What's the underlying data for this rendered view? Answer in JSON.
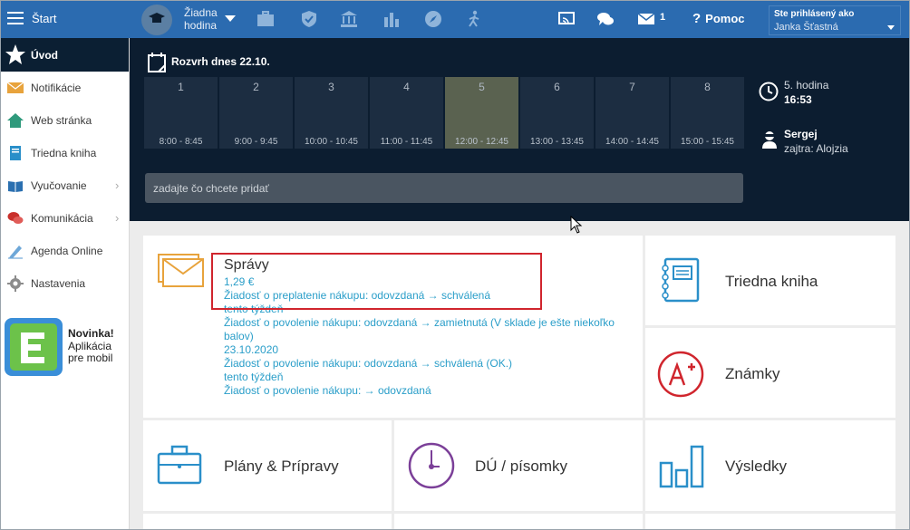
{
  "topbar": {
    "start_label": "Štart",
    "lesson_line1": "Žiadna",
    "lesson_line2": "hodina",
    "message_count": "1",
    "help_label": "Pomoc",
    "help_symbol": "?",
    "logged_in_label": "Ste prihlásený ako",
    "user_name": "Janka Šťastná"
  },
  "sidebar": {
    "items": [
      {
        "label": "Úvod",
        "icon": "star-icon"
      },
      {
        "label": "Notifikácie",
        "icon": "envelope-icon"
      },
      {
        "label": "Web stránka",
        "icon": "house-icon"
      },
      {
        "label": "Triedna kniha",
        "icon": "book-icon"
      },
      {
        "label": "Vyučovanie",
        "icon": "open-book-icon"
      },
      {
        "label": "Komunikácia",
        "icon": "chat-icon"
      },
      {
        "label": "Agenda Online",
        "icon": "pen-icon"
      },
      {
        "label": "Nastavenia",
        "icon": "gear-icon"
      }
    ],
    "promo": {
      "title": "Novinka!",
      "line1": "Aplikácia",
      "line2": "pre mobil"
    }
  },
  "schedule": {
    "title": "Rozvrh dnes 22.10.",
    "periods": [
      {
        "num": "1",
        "time": "8:00 - 8:45"
      },
      {
        "num": "2",
        "time": "9:00 - 9:45"
      },
      {
        "num": "3",
        "time": "10:00 - 10:45"
      },
      {
        "num": "4",
        "time": "11:00 - 11:45"
      },
      {
        "num": "5",
        "time": "12:00 - 12:45"
      },
      {
        "num": "6",
        "time": "13:00 - 13:45"
      },
      {
        "num": "7",
        "time": "14:00 - 14:45"
      },
      {
        "num": "8",
        "time": "15:00 - 15:45"
      }
    ],
    "active_period": "5",
    "add_placeholder": "zadajte čo chcete pridať",
    "current_hour": "5. hodina",
    "current_time": "16:53",
    "birthday_name": "Sergej",
    "birthday_tomorrow": "zajtra: Alojzia"
  },
  "messages": {
    "title": "Správy",
    "feed": [
      "1,29 €",
      "Žiadosť o preplatenie nákupu: odovzdaná → schválená",
      "tento týždeň",
      "Žiadosť o povolenie nákupu: odovzdaná → zamietnutá (V sklade je ešte niekoľko balov)",
      "23.10.2020",
      "Žiadosť o povolenie nákupu: odovzdaná → schválená (OK.)",
      "tento týždeň",
      "Žiadosť o povolenie nákupu: → odovzdaná"
    ]
  },
  "tiles": {
    "class_book": "Triedna kniha",
    "grades": "Známky",
    "plans": "Plány & Prípravy",
    "homework": "DÚ / písomky",
    "results": "Výsledky"
  },
  "colors": {
    "topbar": "#2b6bb0",
    "panel_dark": "#0c1d30",
    "link_blue": "#2a9ec9",
    "highlight_red": "#d0252d",
    "tile_icon_blue": "#2a8fc9",
    "tile_icon_purple": "#7b3f98",
    "tile_icon_red": "#d0252d",
    "envelope_orange": "#e8a33c"
  }
}
